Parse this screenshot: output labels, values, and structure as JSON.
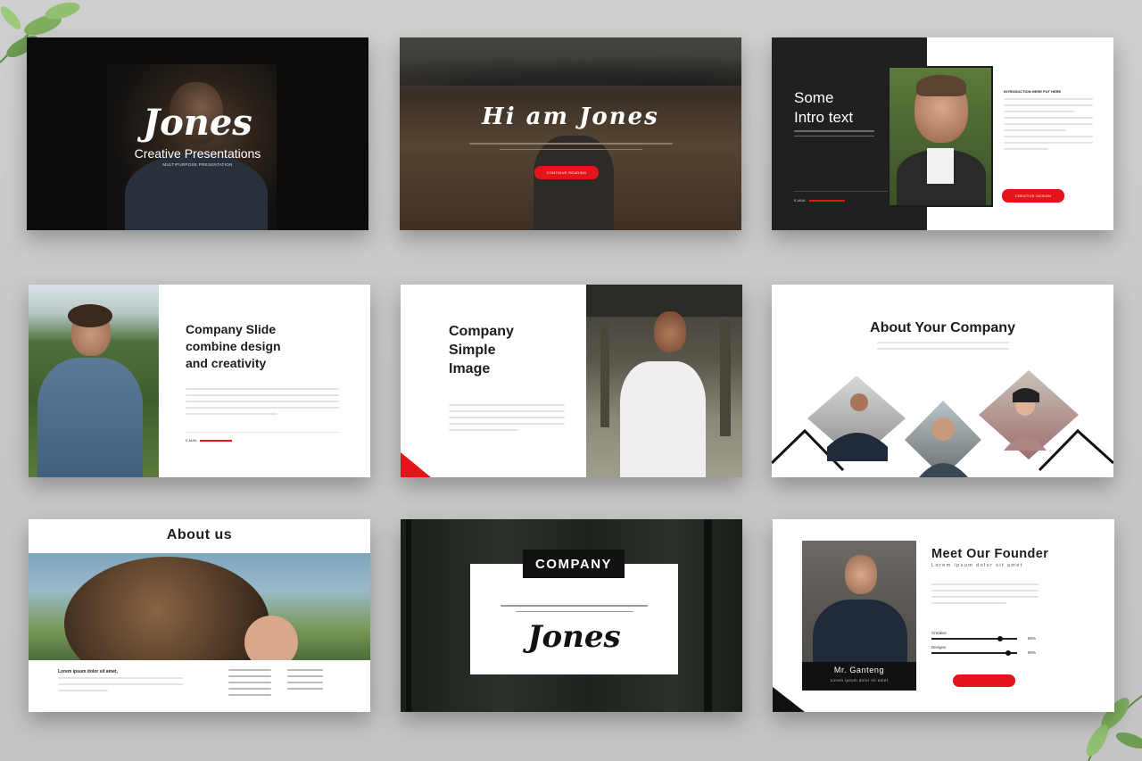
{
  "colors": {
    "accent": "#e4141b",
    "dark": "#1d1d1d",
    "bg": "#c9c9c9"
  },
  "slide1": {
    "title": "Jones",
    "subtitle": "Creative Presentations",
    "tagline": "MULTIPURPOSE PRESENTATION"
  },
  "slide2": {
    "title": "Hi am Jones",
    "button": "CONTINUE READING"
  },
  "slide3": {
    "heading_line1": "Some",
    "heading_line2": "Intro text",
    "right_heading": "INTRODUCTION HERE PUT HERE",
    "email_label": "E-MAIL",
    "button": "CREATIVE DESIGN"
  },
  "slide4": {
    "heading_line1": "Company Slide",
    "heading_line2": "combine design",
    "heading_line3": "and creativity",
    "email_label": "E-MAIL"
  },
  "slide5": {
    "heading_line1": "Company",
    "heading_line2": "Simple",
    "heading_line3": "Image"
  },
  "slide6": {
    "heading": "About Your Company"
  },
  "slide7": {
    "heading": "About us",
    "lorem": "Lorem ipsum dolor sit amet,"
  },
  "slide8": {
    "label": "COMPANY",
    "title": "Jones"
  },
  "slide9": {
    "heading": "Meet Our Founder",
    "sub": "Lorem ipsum dolor sit amet",
    "name": "Mr. Ganteng",
    "name_sub": "Lorem ipsum dolor sit amet",
    "skills": [
      {
        "label": "Creative",
        "percent": 80
      },
      {
        "label": "Designs",
        "percent": 90
      }
    ]
  }
}
